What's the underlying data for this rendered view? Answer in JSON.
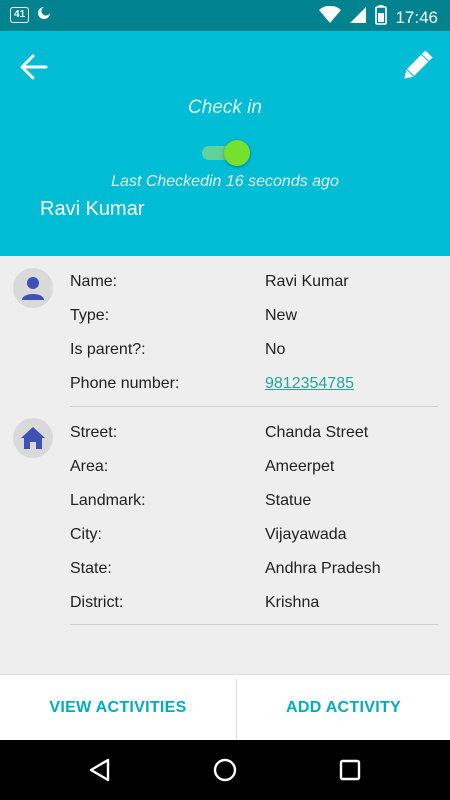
{
  "status_bar": {
    "sim_label": "4",
    "time": "17:46",
    "icons": [
      "sim-icon",
      "notification-icon",
      "wifi-icon",
      "signal-icon",
      "battery-icon"
    ]
  },
  "header": {
    "back_icon": "arrow-back-icon",
    "edit_icon": "pencil-icon",
    "checkin_title": "Check in",
    "checkin_on": true,
    "last_checkin": "Last Checkedin 16 seconds ago",
    "name": "Ravi Kumar",
    "colors": {
      "background": "#00bcd4",
      "status_bar": "#00838f",
      "toggle_on": "#76e02f"
    }
  },
  "personal": {
    "icon": "person-icon",
    "fields": [
      {
        "label": "Name:",
        "value": "Ravi Kumar"
      },
      {
        "label": "Type:",
        "value": "New"
      },
      {
        "label": "Is parent?:",
        "value": "No"
      },
      {
        "label": "Phone number:",
        "value": "9812354785"
      }
    ]
  },
  "address": {
    "icon": "home-icon",
    "fields": [
      {
        "label": "Street:",
        "value": "Chanda Street"
      },
      {
        "label": "Area:",
        "value": "Ameerpet"
      },
      {
        "label": "Landmark:",
        "value": "Statue"
      },
      {
        "label": "City:",
        "value": "Vijayawada"
      },
      {
        "label": "State:",
        "value": "Andhra Pradesh"
      },
      {
        "label": "District:",
        "value": "Krishna"
      }
    ]
  },
  "actions": {
    "view_activities": "VIEW ACTIVITIES",
    "add_activity": "ADD ACTIVITY",
    "accent": "#00acc1"
  },
  "nav": {
    "icons": [
      "back-triangle-icon",
      "home-circle-icon",
      "recents-square-icon"
    ]
  }
}
